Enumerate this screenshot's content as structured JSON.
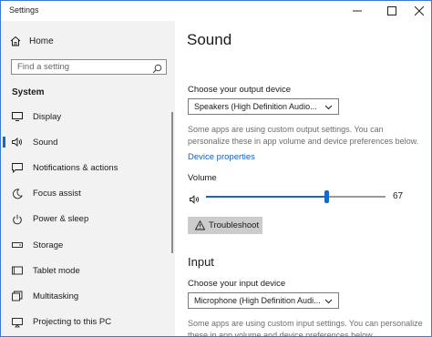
{
  "window": {
    "title": "Settings",
    "controls": {
      "minimize": "—",
      "maximize": "☐",
      "close": "✕"
    }
  },
  "sidebar": {
    "home_label": "Home",
    "search_placeholder": "Find a setting",
    "section_title": "System",
    "items": [
      {
        "label": "Display",
        "icon": "display-icon"
      },
      {
        "label": "Sound",
        "icon": "speaker-icon",
        "active": true
      },
      {
        "label": "Notifications & actions",
        "icon": "notifications-icon"
      },
      {
        "label": "Focus assist",
        "icon": "moon-icon"
      },
      {
        "label": "Power & sleep",
        "icon": "power-icon"
      },
      {
        "label": "Storage",
        "icon": "storage-icon"
      },
      {
        "label": "Tablet mode",
        "icon": "tablet-icon"
      },
      {
        "label": "Multitasking",
        "icon": "multitasking-icon"
      },
      {
        "label": "Projecting to this PC",
        "icon": "projecting-icon"
      }
    ]
  },
  "main": {
    "title": "Sound",
    "output": {
      "label": "Choose your output device",
      "selected": "Speakers (High Definition Audio...",
      "description": "Some apps are using custom output settings. You can personalize these in app volume and device preferences below.",
      "device_properties": "Device properties",
      "volume_label": "Volume",
      "volume_value": "67",
      "volume_level": 0.67,
      "troubleshoot": "Troubleshoot"
    },
    "input": {
      "heading": "Input",
      "label": "Choose your input device",
      "selected": "Microphone (High Definition Audi...",
      "description": "Some apps are using custom input settings. You can personalize these in app volume and device preferences below."
    }
  },
  "colors": {
    "accent": "#1769c4",
    "link": "#1a5fb4",
    "sidebar_bg": "#f2f2f2"
  }
}
